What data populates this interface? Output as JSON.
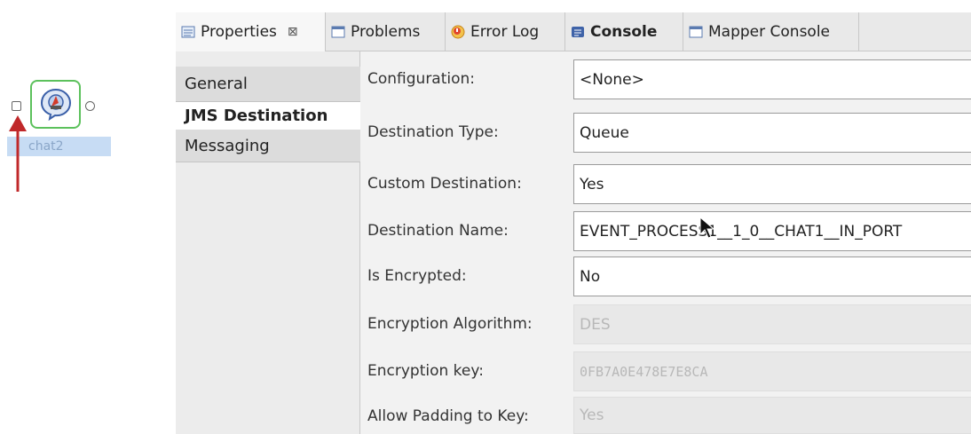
{
  "canvas": {
    "node_label": "chat2"
  },
  "tabs": [
    {
      "label": "Properties",
      "icon": "properties-icon",
      "close": "⊠",
      "active": true
    },
    {
      "label": "Problems",
      "icon": "problems-icon"
    },
    {
      "label": "Error Log",
      "icon": "error-log-icon"
    },
    {
      "label": "Console",
      "icon": "console-icon",
      "bold": true
    },
    {
      "label": "Mapper Console",
      "icon": "mapper-console-icon"
    }
  ],
  "sidebar": {
    "items": [
      {
        "label": "General"
      },
      {
        "label": "JMS Destination",
        "selected": true
      },
      {
        "label": "Messaging"
      }
    ]
  },
  "form": {
    "rows": [
      {
        "label": "Configuration:",
        "value": "<None>",
        "enabled": true
      },
      {
        "label": "Destination Type:",
        "value": "Queue",
        "enabled": true
      },
      {
        "label": "Custom Destination:",
        "value": "Yes",
        "enabled": true
      },
      {
        "label": "Destination Name:",
        "value": "EVENT_PROCESS1__1_0__CHAT1__IN_PORT",
        "enabled": true
      },
      {
        "label": "Is Encrypted:",
        "value": "No",
        "enabled": true
      },
      {
        "label": "Encryption Algorithm:",
        "value": "DES",
        "enabled": false
      },
      {
        "label": "Encryption key:",
        "value": "0FB7A0E478E7E8CA",
        "enabled": false
      },
      {
        "label": "Allow Padding to Key:",
        "value": "Yes",
        "enabled": false
      }
    ]
  },
  "colors": {
    "node_border": "#5cc15c",
    "selection_label_bg": "#c7dcf4",
    "arrow": "#c0282a"
  }
}
